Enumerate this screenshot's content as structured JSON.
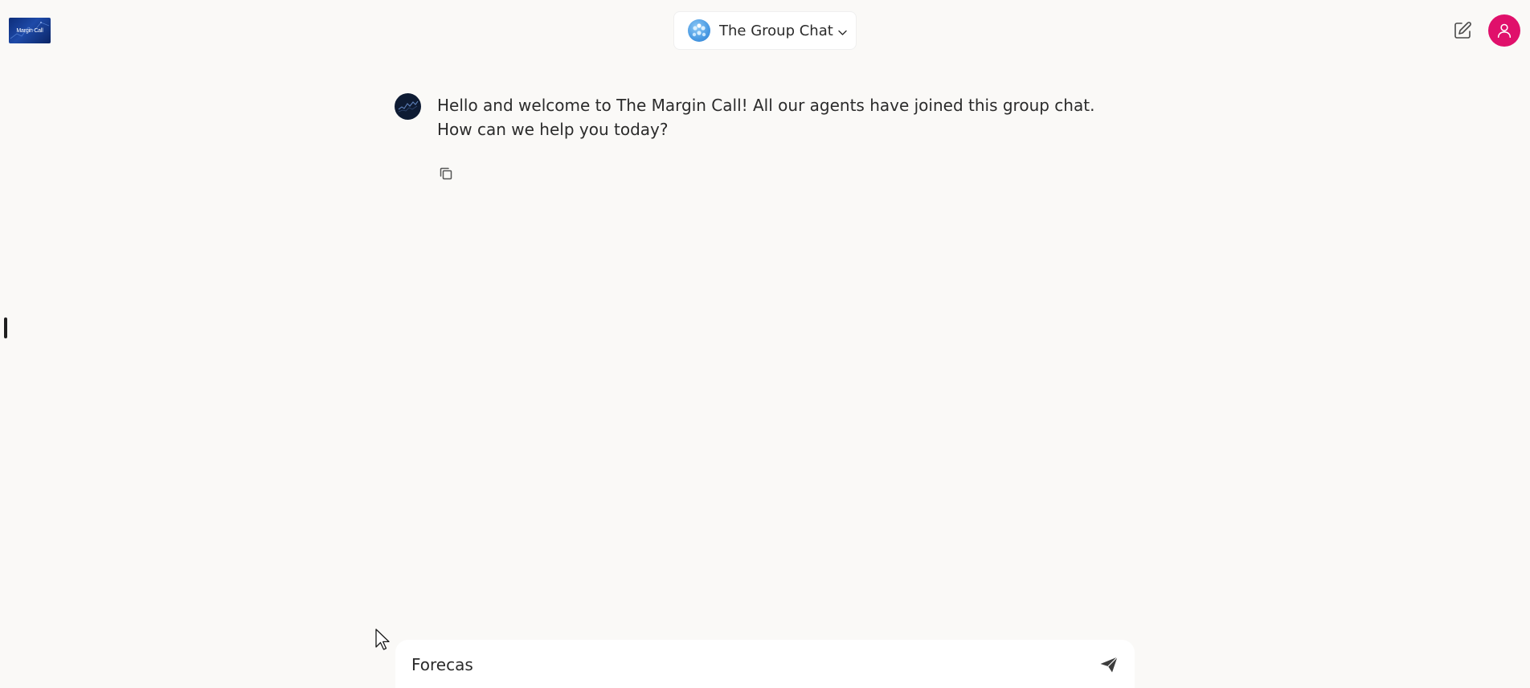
{
  "header": {
    "logo_text": "Margin Call",
    "chat_title": "The Group Chat",
    "icons": {
      "chat_avatar": "group-avatar-icon",
      "dropdown": "chevron-down-icon",
      "compose": "edit-icon",
      "user": "user-icon"
    }
  },
  "messages": [
    {
      "text": "Hello and welcome to The Margin Call! All our agents have joined this group chat. How can we help you today?",
      "avatar_icon": "chart-line-icon",
      "actions": [
        "copy-icon"
      ]
    }
  ],
  "composer": {
    "value": "Forecas",
    "send_icon": "send-icon"
  },
  "colors": {
    "background": "#faf9f7",
    "user_avatar": "#e0106b",
    "bot_avatar": "#0e1b33",
    "logo": "#1e4aa8"
  }
}
